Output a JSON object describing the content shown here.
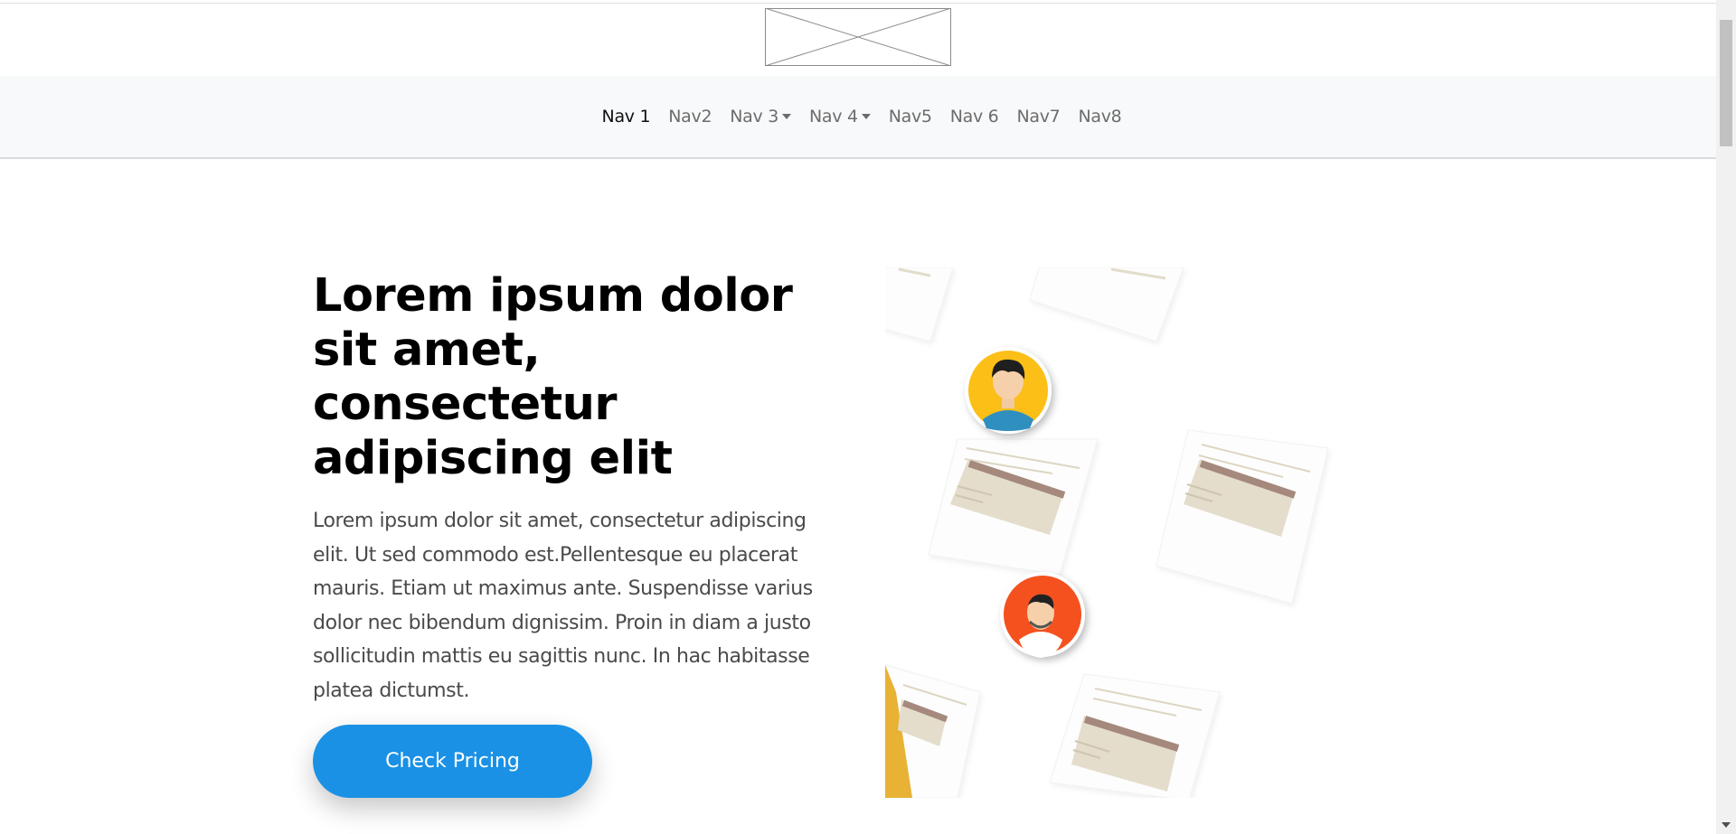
{
  "nav": {
    "items": [
      {
        "label": "Nav 1",
        "active": true,
        "dropdown": false
      },
      {
        "label": "Nav2",
        "active": false,
        "dropdown": false
      },
      {
        "label": "Nav 3",
        "active": false,
        "dropdown": true
      },
      {
        "label": "Nav 4",
        "active": false,
        "dropdown": true
      },
      {
        "label": "Nav5",
        "active": false,
        "dropdown": false
      },
      {
        "label": "Nav 6",
        "active": false,
        "dropdown": false
      },
      {
        "label": "Nav7",
        "active": false,
        "dropdown": false
      },
      {
        "label": "Nav8",
        "active": false,
        "dropdown": false
      }
    ]
  },
  "hero": {
    "title": "Lorem ipsum dolor sit amet, consectetur adipiscing elit",
    "text": "Lorem ipsum dolor sit amet, consectetur adipiscing elit. Ut sed commodo est.Pellentesque eu placerat mauris. Etiam ut maximus ante. Suspendisse varius dolor nec bibendum dignissim. Proin in diam a justo sollicitudin mattis eu sagittis nunc. In hac habitasse platea dictumst.",
    "cta_label": "Check Pricing"
  },
  "colors": {
    "accent": "#1a91e5",
    "navbar_bg": "#f8f9fa",
    "avatar_yellow": "#fbbf17",
    "avatar_orange": "#f4511e"
  }
}
